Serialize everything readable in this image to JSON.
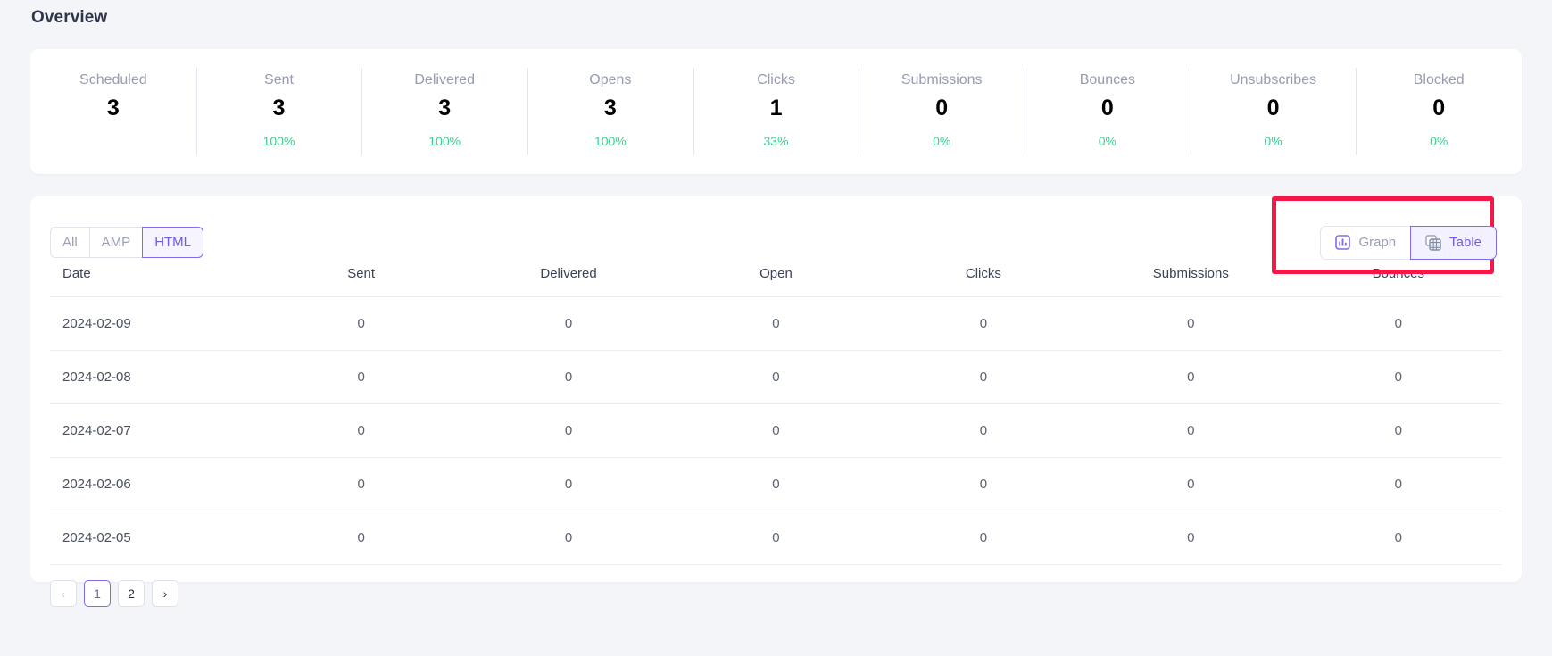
{
  "page": {
    "title": "Overview",
    "accent_color": "#6c5ce7",
    "positive_color": "#3ecf8e",
    "highlight_color": "#f31847"
  },
  "stats": [
    {
      "label": "Scheduled",
      "value": "3",
      "pct": ""
    },
    {
      "label": "Sent",
      "value": "3",
      "pct": "100%"
    },
    {
      "label": "Delivered",
      "value": "3",
      "pct": "100%"
    },
    {
      "label": "Opens",
      "value": "3",
      "pct": "100%"
    },
    {
      "label": "Clicks",
      "value": "1",
      "pct": "33%"
    },
    {
      "label": "Submissions",
      "value": "0",
      "pct": "0%"
    },
    {
      "label": "Bounces",
      "value": "0",
      "pct": "0%"
    },
    {
      "label": "Unsubscribes",
      "value": "0",
      "pct": "0%"
    },
    {
      "label": "Blocked",
      "value": "0",
      "pct": "0%"
    }
  ],
  "filter_tabs": [
    {
      "label": "All",
      "active": false
    },
    {
      "label": "AMP",
      "active": false
    },
    {
      "label": "HTML",
      "active": true
    }
  ],
  "view_switch": [
    {
      "label": "Graph",
      "icon": "bar-chart-icon",
      "active": false
    },
    {
      "label": "Table",
      "icon": "table-grid-icon",
      "active": true
    }
  ],
  "table": {
    "columns": [
      "Date",
      "Sent",
      "Delivered",
      "Open",
      "Clicks",
      "Submissions",
      "Bounces"
    ],
    "rows": [
      [
        "2024-02-09",
        "0",
        "0",
        "0",
        "0",
        "0",
        "0"
      ],
      [
        "2024-02-08",
        "0",
        "0",
        "0",
        "0",
        "0",
        "0"
      ],
      [
        "2024-02-07",
        "0",
        "0",
        "0",
        "0",
        "0",
        "0"
      ],
      [
        "2024-02-06",
        "0",
        "0",
        "0",
        "0",
        "0",
        "0"
      ],
      [
        "2024-02-05",
        "0",
        "0",
        "0",
        "0",
        "0",
        "0"
      ]
    ]
  },
  "pagination": {
    "prev": "‹",
    "next": "›",
    "pages": [
      "1",
      "2"
    ],
    "current": "1"
  }
}
